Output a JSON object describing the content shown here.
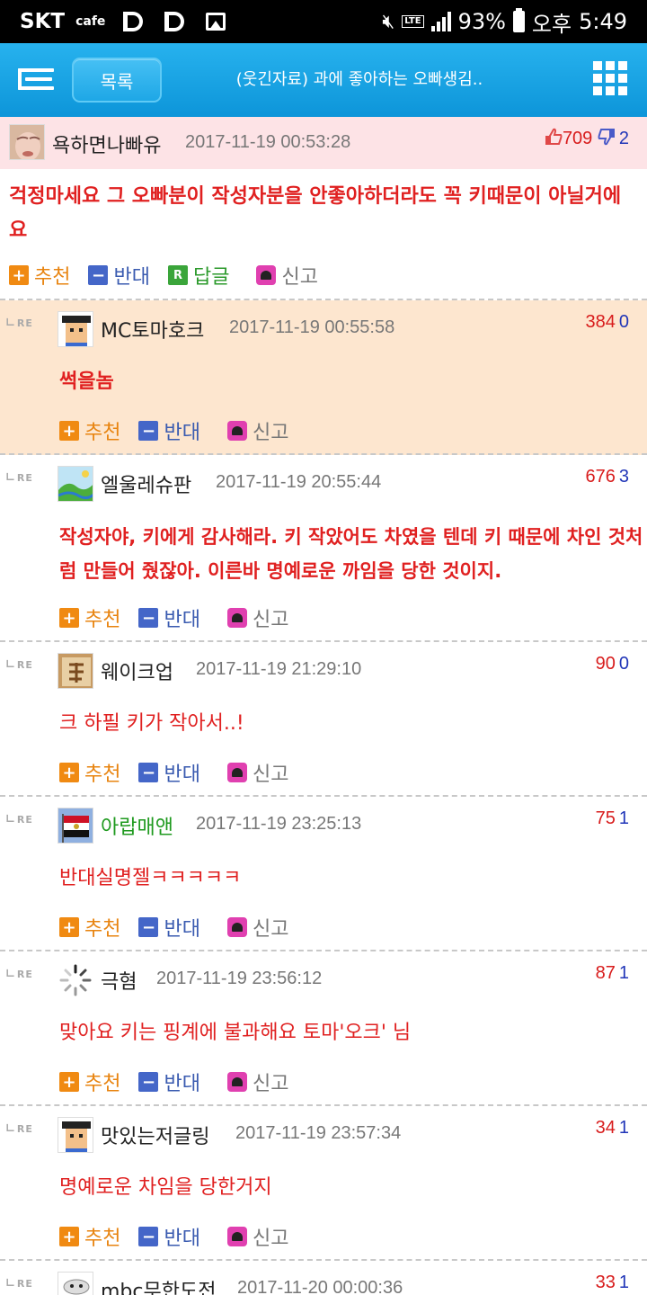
{
  "status_bar": {
    "carrier": "SKT",
    "cafe_label": "cafe",
    "battery": "93%",
    "ampm": "오후",
    "time": "5:49"
  },
  "app_bar": {
    "list_button": "목록",
    "title": "(웃긴자료) 과에 좋아하는 오빠생김.."
  },
  "main_comment": {
    "nickname": "욕하면나빠유",
    "timestamp": "2017-11-19 00:53:28",
    "up": "709",
    "down": "2",
    "body": "걱정마세요 그 오빠분이 작성자분을 안좋아하더라도 꼭 키때문이 아닐거에요",
    "actions": {
      "recommend": "추천",
      "oppose": "반대",
      "reply": "답글",
      "report": "신고"
    }
  },
  "re_label": "RE",
  "replies": [
    {
      "nickname": "MC토마호크",
      "timestamp": "2017-11-19 00:55:58",
      "up": "384",
      "down": "0",
      "body": "썩을놈",
      "bold": true,
      "highlight": true
    },
    {
      "nickname": "엘울레슈판",
      "timestamp": "2017-11-19 20:55:44",
      "up": "676",
      "down": "3",
      "body": "작성자야, 키에게 감사해라. 키 작았어도 차였을 텐데 키 때문에 차인 것처럼 만들어 줬잖아. 이른바 명예로운 까임을 당한 것이지.",
      "bold": true
    },
    {
      "nickname": "웨이크업",
      "timestamp": "2017-11-19 21:29:10",
      "up": "90",
      "down": "0",
      "body": "크 하필 키가 작아서..!",
      "bold": false
    },
    {
      "nickname": "아랍매앤",
      "timestamp": "2017-11-19 23:25:13",
      "up": "75",
      "down": "1",
      "body": "반대실명젤ㅋㅋㅋㅋㅋ",
      "bold": false
    },
    {
      "nickname": "극혐",
      "timestamp": "2017-11-19 23:56:12",
      "up": "87",
      "down": "1",
      "body": "맞아요 키는 핑계에 불과해요 토마'오크' 님",
      "bold": false
    },
    {
      "nickname": "맛있는저글링",
      "timestamp": "2017-11-19 23:57:34",
      "up": "34",
      "down": "1",
      "body": "명예로운 차임을 당한거지",
      "bold": false
    },
    {
      "nickname": "mbc무한도전",
      "timestamp": "2017-11-20 00:00:36",
      "up": "33",
      "down": "1",
      "body": "",
      "bold": false
    }
  ],
  "reply_actions": {
    "recommend": "추천",
    "oppose": "반대",
    "report": "신고"
  },
  "colors": {
    "app_bar": "#1ea7e6",
    "main_header": "#fde3e6",
    "highlight_reply": "#fde6cf",
    "body_text": "#e02020",
    "up_votes": "#d81c1c",
    "down_votes": "#2136b8"
  }
}
